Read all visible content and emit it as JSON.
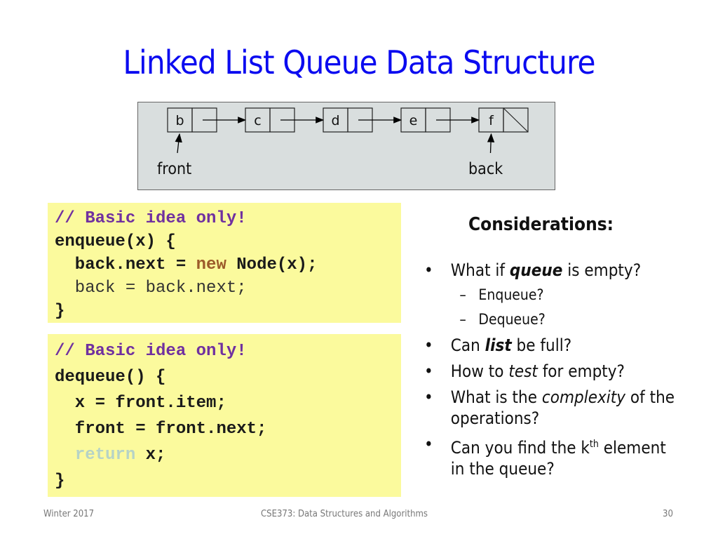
{
  "slide": {
    "title": "Linked List Queue Data Structure",
    "diagram": {
      "nodes": [
        {
          "value": "b",
          "next": "arrow"
        },
        {
          "value": "c",
          "next": "arrow"
        },
        {
          "value": "d",
          "next": "arrow"
        },
        {
          "value": "e",
          "next": "arrow"
        },
        {
          "value": "f",
          "next": "null"
        }
      ],
      "front_label": "front",
      "back_label": "back"
    },
    "enqueue_code": {
      "comment": "// Basic idea only!",
      "line1": "enqueue(x) {",
      "line2_a": "  back.next = ",
      "line2_kw": "new",
      "line2_b": " Node(x);",
      "line3": "  back = back.next;",
      "line4": "}"
    },
    "dequeue_code": {
      "comment": "// Basic idea only!",
      "line1": "dequeue() {",
      "line2": "  x = front.item;",
      "line3": "  front = front.next;",
      "line4_indent": "  ",
      "line4_kw": "return",
      "line4_b": " x;",
      "line5": "}"
    },
    "considerations": {
      "title": "Considerations:",
      "bullet_symbol": "•",
      "dash_symbol": "–",
      "items": [
        {
          "pre": "What if ",
          "em": "queue",
          "post": " is empty?",
          "em_style": "bold-italic"
        },
        {
          "sub": "Enqueue?"
        },
        {
          "sub": "Dequeue?"
        },
        {
          "pre": "Can ",
          "em": "list",
          "post": " be full?",
          "em_style": "bold-italic"
        },
        {
          "pre": "How to ",
          "em": "test",
          "post": " for empty?",
          "em_style": "italic"
        },
        {
          "pre": "What is the ",
          "em": "complexity",
          "post": " of the operations?",
          "em_style": "italic"
        },
        {
          "pre": "Can you find the k",
          "sup": "th",
          "post": " element in the queue?"
        }
      ]
    },
    "footer": {
      "left": "Winter 2017",
      "center": "CSE373: Data Structures and Algorithms",
      "page": "30"
    }
  }
}
